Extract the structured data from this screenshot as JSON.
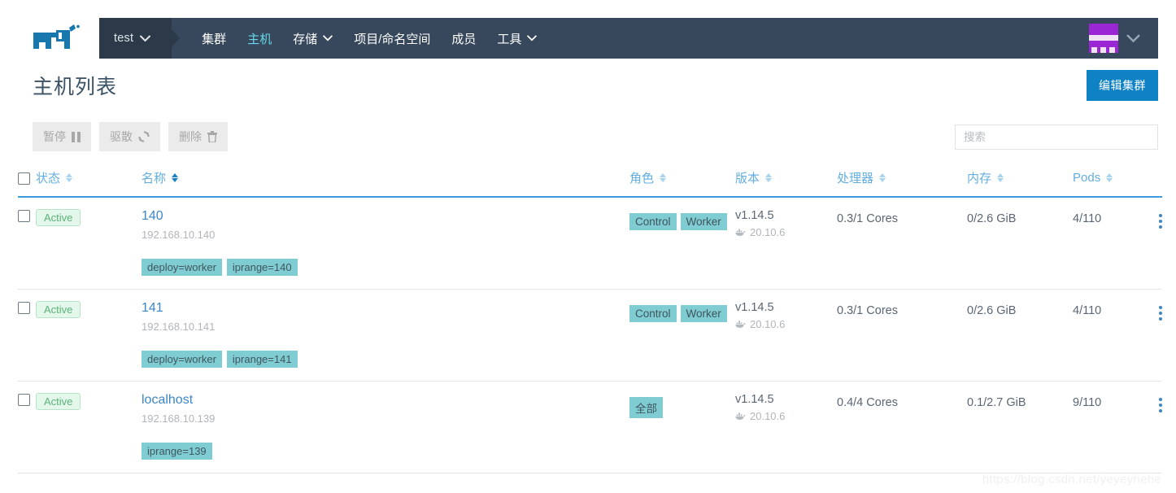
{
  "nav": {
    "logo_name": "rancher-cow-logo",
    "cluster_switcher": {
      "label": "test"
    },
    "items": [
      {
        "name": "cluster",
        "label": "集群",
        "active": false,
        "caret": false
      },
      {
        "name": "hosts",
        "label": "主机",
        "active": true,
        "caret": false
      },
      {
        "name": "storage",
        "label": "存储",
        "active": false,
        "caret": true
      },
      {
        "name": "projects",
        "label": "项目/命名空间",
        "active": false,
        "caret": false
      },
      {
        "name": "members",
        "label": "成员",
        "active": false,
        "caret": false
      },
      {
        "name": "tools",
        "label": "工具",
        "active": false,
        "caret": true
      }
    ],
    "avatar_label": "user-avatar",
    "bar_color": "#37485c",
    "switcher_color": "#2b3949",
    "active_color": "#66d7e8"
  },
  "header": {
    "page_title": "主机列表",
    "edit_cluster_label": "编辑集群",
    "primary_color": "#0f82c5"
  },
  "toolbar": {
    "buttons": [
      {
        "name": "pause-button",
        "label": "暂停",
        "icon": "pause-icon"
      },
      {
        "name": "evacuate-button",
        "label": "驱散",
        "icon": "refresh-icon"
      },
      {
        "name": "delete-button",
        "label": "删除",
        "icon": "trash-icon"
      }
    ],
    "search_placeholder": "搜索",
    "search_value": ""
  },
  "table": {
    "columns": [
      {
        "key": "checkbox",
        "label": "",
        "sortable": false,
        "sorted": false
      },
      {
        "key": "state",
        "label": "状态",
        "sortable": true,
        "sorted": false
      },
      {
        "key": "name",
        "label": "名称",
        "sortable": true,
        "sorted": true
      },
      {
        "key": "role",
        "label": "角色",
        "sortable": true,
        "sorted": false
      },
      {
        "key": "version",
        "label": "版本",
        "sortable": true,
        "sorted": false
      },
      {
        "key": "cpu",
        "label": "处理器",
        "sortable": true,
        "sorted": false
      },
      {
        "key": "memory",
        "label": "内存",
        "sortable": true,
        "sorted": false
      },
      {
        "key": "pods",
        "label": "Pods",
        "sortable": true,
        "sorted": false
      }
    ],
    "rows": [
      {
        "state": "Active",
        "name": "140",
        "ip": "192.168.10.140",
        "labels": [
          "deploy=worker",
          "iprange=140"
        ],
        "roles": [
          "Control",
          "Worker"
        ],
        "k8s_version": "v1.14.5",
        "docker_version": "20.10.6",
        "cpu": "0.3/1 Cores",
        "memory": "0/2.6 GiB",
        "pods": "4/110"
      },
      {
        "state": "Active",
        "name": "141",
        "ip": "192.168.10.141",
        "labels": [
          "deploy=worker",
          "iprange=141"
        ],
        "roles": [
          "Control",
          "Worker"
        ],
        "k8s_version": "v1.14.5",
        "docker_version": "20.10.6",
        "cpu": "0.3/1 Cores",
        "memory": "0/2.6 GiB",
        "pods": "4/110"
      },
      {
        "state": "Active",
        "name": "localhost",
        "ip": "192.168.10.139",
        "labels": [
          "iprange=139"
        ],
        "roles": [
          "全部"
        ],
        "k8s_version": "v1.14.5",
        "docker_version": "20.10.6",
        "cpu": "0.4/4 Cores",
        "memory": "0.1/2.7 GiB",
        "pods": "9/110"
      }
    ]
  },
  "watermark": {
    "text": "https://blog.csdn.net/yeyeyhehe"
  }
}
